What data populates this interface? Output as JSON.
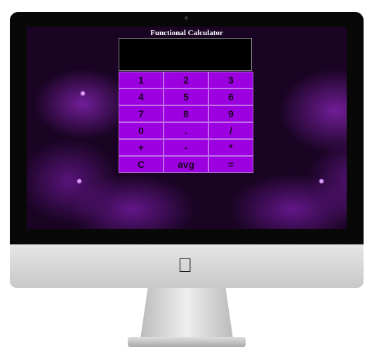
{
  "title": "Functional Calculator",
  "display": "",
  "buttons": [
    "1",
    "2",
    "3",
    "4",
    "5",
    "6",
    "7",
    "8",
    "9",
    "0",
    ".",
    "/",
    "+",
    "-",
    "*",
    "C",
    "avg",
    "="
  ]
}
